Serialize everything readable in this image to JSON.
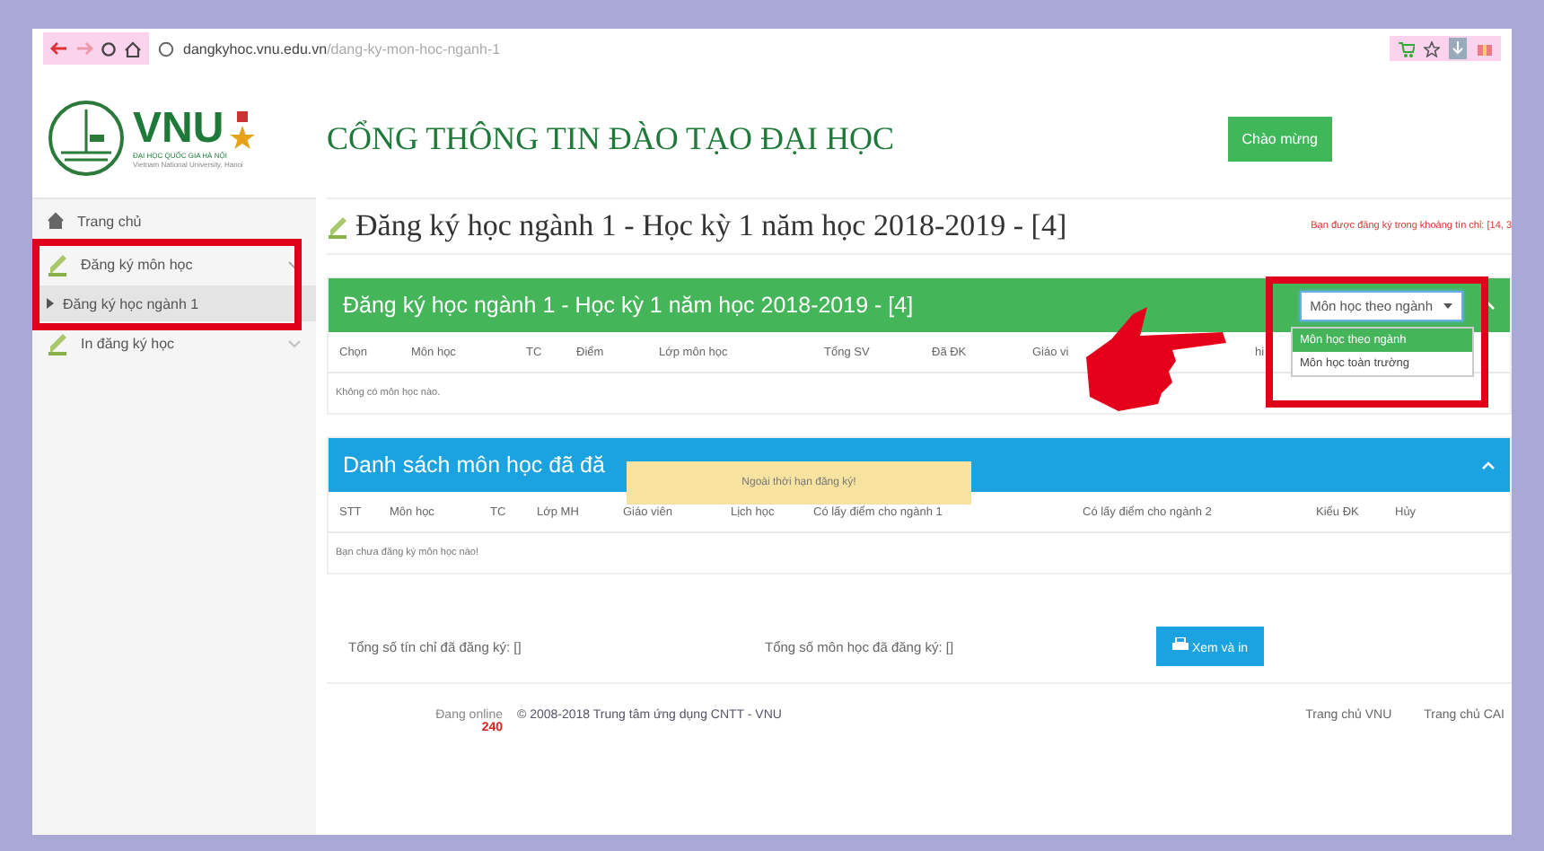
{
  "browser": {
    "url_host": "dangkyhoc.vnu.edu.vn",
    "url_path": "/dang-ky-mon-hoc-nganh-1"
  },
  "header": {
    "logo_text": "VNU",
    "logo_subtitle": "ĐẠI HỌC QUỐC GIA HÀ NỘI",
    "logo_subtitle_en": "Vietnam National University, Hanoi",
    "portal_title": "CỔNG THÔNG TIN ĐÀO TẠO ĐẠI HỌC",
    "welcome_button": "Chào mừng"
  },
  "sidebar": {
    "items": [
      {
        "label": "Trang chủ",
        "selected": false
      },
      {
        "label": "Đăng ký môn học",
        "selected": false,
        "expanded": true,
        "children": [
          {
            "label": "Đăng ký học ngành 1",
            "selected": true
          }
        ]
      },
      {
        "label": "In đăng ký học",
        "selected": false,
        "expanded": false
      }
    ]
  },
  "page": {
    "title": "Đăng ký học ngành 1 - Học kỳ 1 năm học 2018-2019 - [4]",
    "notice": "Bạn được đăng ký trong khoảng tín chỉ: [14, 3"
  },
  "register_panel": {
    "title": "Đăng ký học ngành 1 - Học kỳ 1 năm học 2018-2019 - [4]",
    "filter": {
      "value": "Môn học theo ngành",
      "expanded": true,
      "options": [
        {
          "label": "Môn học theo ngành",
          "selected": true
        },
        {
          "label": "Môn học toàn trường",
          "selected": false
        }
      ]
    },
    "columns": [
      "Chọn",
      "Môn học",
      "TC",
      "Điểm",
      "Lớp môn học",
      "Tổng SV",
      "Đã ĐK",
      "Giáo vi",
      "hi"
    ],
    "empty_text": "Không có môn học nào."
  },
  "registered_panel": {
    "title": "Danh sách môn học đã đă",
    "columns": [
      "STT",
      "Môn học",
      "TC",
      "Lớp MH",
      "Giáo viên",
      "Lịch học",
      "Có lấy điểm cho ngành 1",
      "Có lấy điểm cho ngành 2",
      "Kiểu ĐK",
      "Hủy"
    ],
    "empty_text": "Bạn chưa đăng ký môn học nào!"
  },
  "tooltip": "Ngoài thời hạn đăng ký!",
  "totals": {
    "credits": "Tổng số tín chỉ đã đăng ký: []",
    "subjects": "Tổng số môn học đã đăng ký: []",
    "print_button": "Xem và in"
  },
  "footer": {
    "online_label": "Đang online",
    "online_count": "240",
    "copyright": "© 2008-2018 Trung tâm ứng dụng CNTT - VNU",
    "links": [
      "Trang chủ VNU",
      "Trang chủ CAI"
    ]
  }
}
